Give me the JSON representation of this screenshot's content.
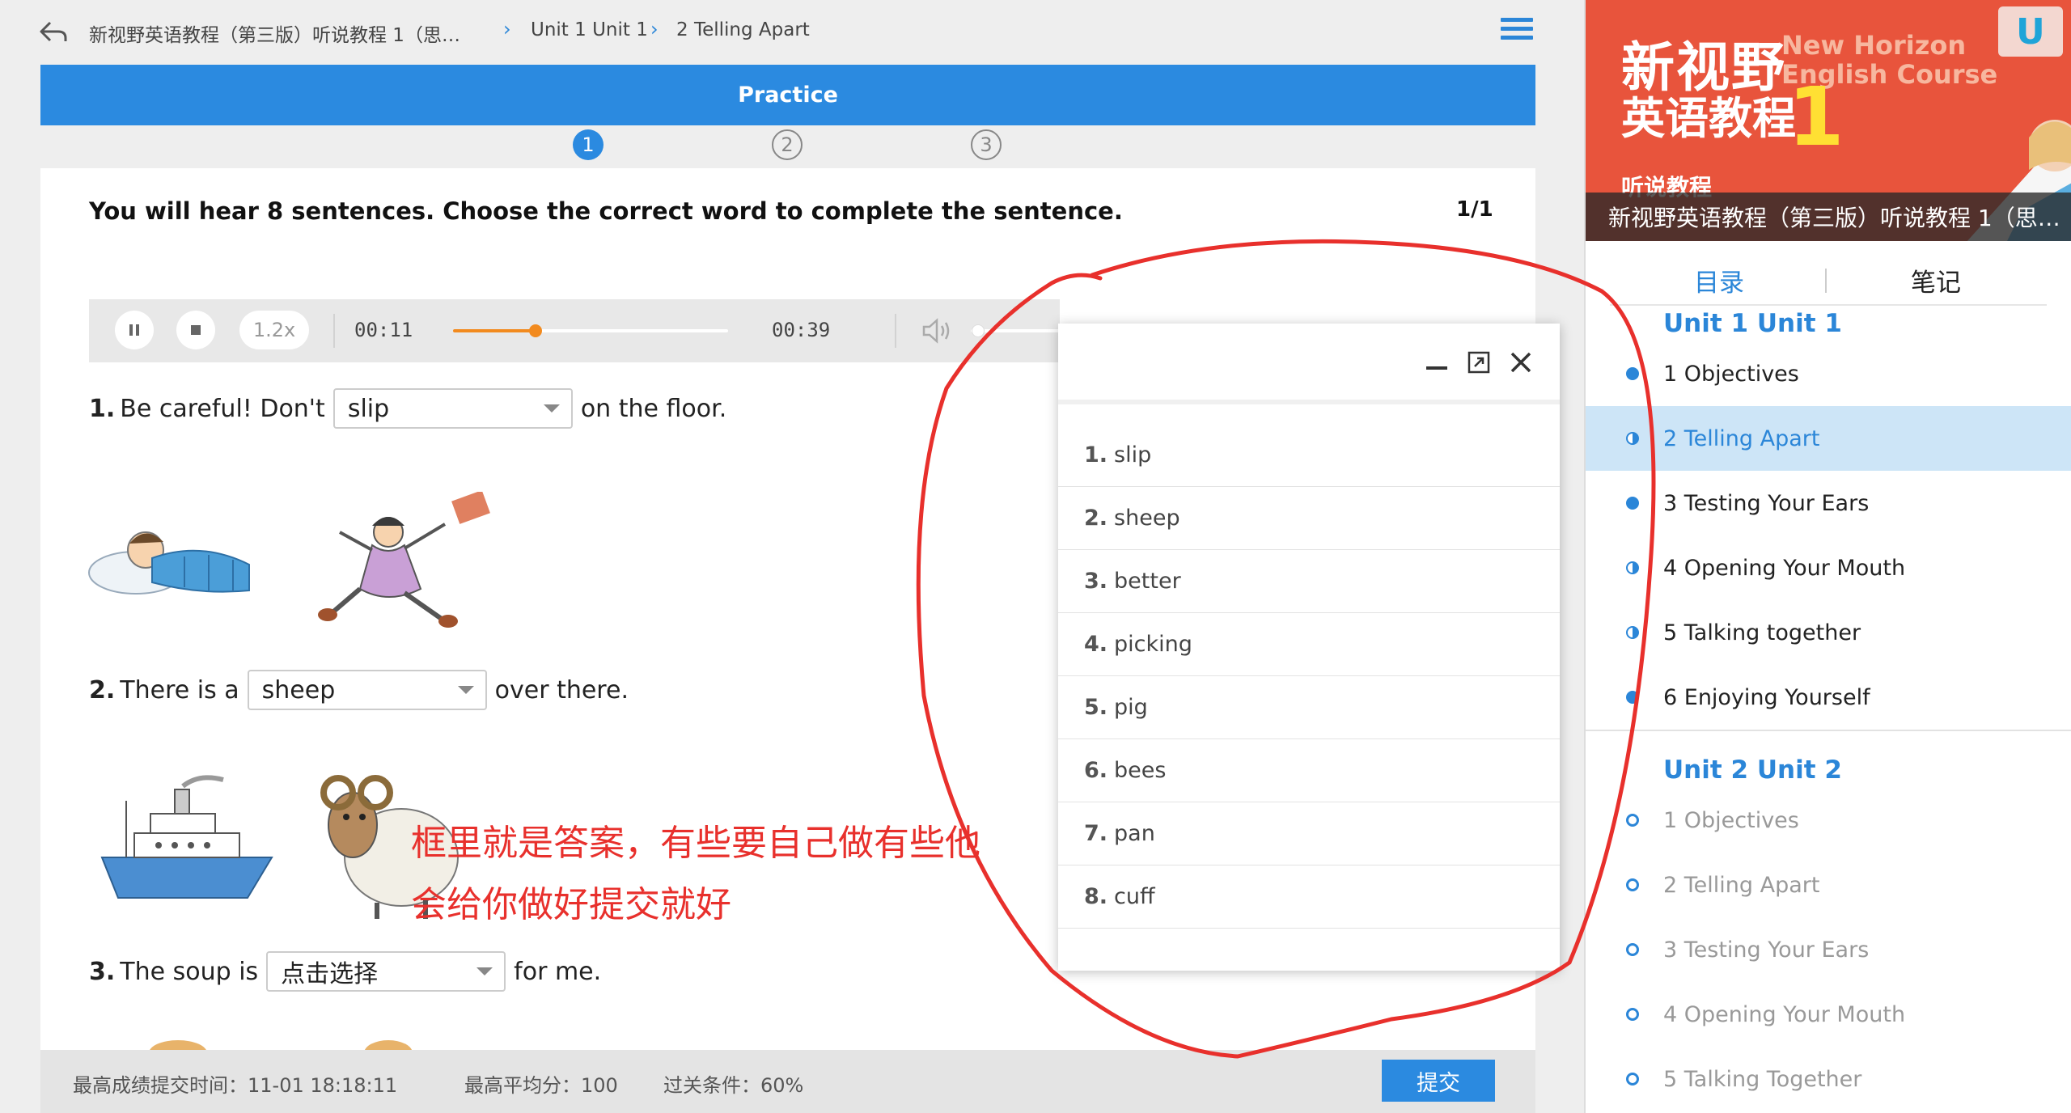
{
  "breadcrumb": {
    "course": "新视野英语教程（第三版）听说教程 1（思…",
    "unit": "Unit 1 Unit 1",
    "section": "2 Telling Apart"
  },
  "practice": {
    "title": "Practice",
    "steps": [
      "1",
      "2",
      "3"
    ],
    "instruction": "You will hear 8 sentences. Choose the correct word to complete the sentence.",
    "page_count": "1/1"
  },
  "player": {
    "speed": "1.2x",
    "current_time": "00:11",
    "total_time": "00:39",
    "progress": 0.3,
    "volume": 0.02
  },
  "questions": [
    {
      "num": "1.",
      "before": "Be careful! Don't",
      "selected": "slip",
      "after": "on the floor."
    },
    {
      "num": "2.",
      "before": "There is a",
      "selected": "sheep",
      "after": "over there."
    },
    {
      "num": "3.",
      "before": "The soup is",
      "selected": "点击选择",
      "after": "for me."
    }
  ],
  "footer": {
    "submit_time": "最高成绩提交时间：11-01 18:18:11",
    "avg_score": "最高平均分：100",
    "pass_condition": "过关条件：60%",
    "submit_label": "提交"
  },
  "popup": {
    "answers": [
      {
        "num": "1.",
        "word": "slip"
      },
      {
        "num": "2.",
        "word": "sheep"
      },
      {
        "num": "3.",
        "word": "better"
      },
      {
        "num": "4.",
        "word": "picking"
      },
      {
        "num": "5.",
        "word": "pig"
      },
      {
        "num": "6.",
        "word": "bees"
      },
      {
        "num": "7.",
        "word": "pan"
      },
      {
        "num": "8.",
        "word": "cuff"
      }
    ]
  },
  "annotation": {
    "line1": "框里就是答案，有些要自己做有些他",
    "line2": "会给你做好提交就好"
  },
  "sidebar": {
    "cover": {
      "title_line1": "新视野",
      "title_en1": "New Horizon",
      "title_en2": "English Course",
      "title_line2": "英语教程",
      "volume": "1",
      "subtitle": "听说教程",
      "caption": "新视野英语教程（第三版）听说教程 1（思…"
    },
    "tabs": {
      "contents": "目录",
      "notes": "笔记"
    },
    "units": [
      {
        "title": "Unit 1 Unit 1",
        "items": [
          {
            "label": "1 Objectives",
            "status": "full"
          },
          {
            "label": "2 Telling Apart",
            "status": "half"
          },
          {
            "label": "3 Testing Your Ears",
            "status": "full"
          },
          {
            "label": "4 Opening Your Mouth",
            "status": "half"
          },
          {
            "label": "5 Talking together",
            "status": "half"
          },
          {
            "label": "6 Enjoying Yourself",
            "status": "full"
          }
        ]
      },
      {
        "title": "Unit 2 Unit 2",
        "items": [
          {
            "label": "1 Objectives",
            "status": "empty"
          },
          {
            "label": "2 Telling Apart",
            "status": "empty"
          },
          {
            "label": "3 Testing Your Ears",
            "status": "empty"
          },
          {
            "label": "4 Opening Your Mouth",
            "status": "empty"
          },
          {
            "label": "5 Talking Together",
            "status": "empty"
          }
        ]
      }
    ]
  },
  "colors": {
    "accent": "#2b8ae0",
    "progress": "#f28a1e",
    "annotation": "#e8302c",
    "active_row": "#cde5f7"
  }
}
